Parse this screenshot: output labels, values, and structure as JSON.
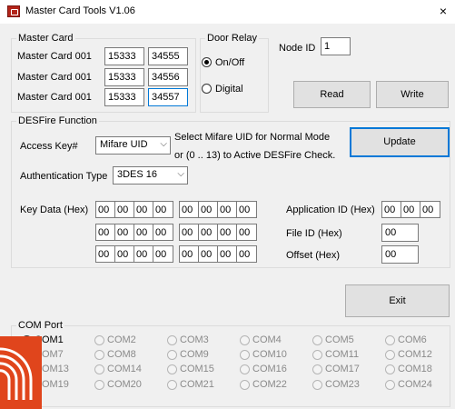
{
  "window": {
    "title": "Master Card Tools V1.06",
    "close": "×"
  },
  "master_card": {
    "legend": "Master Card",
    "rows": [
      {
        "label": "Master Card 001",
        "v1": "15333",
        "v2": "34555"
      },
      {
        "label": "Master Card 001",
        "v1": "15333",
        "v2": "34556"
      },
      {
        "label": "Master Card 001",
        "v1": "15333",
        "v2": "34557"
      }
    ]
  },
  "door_relay": {
    "legend": "Door Relay",
    "opt1": "On/Off",
    "opt2": "Digital"
  },
  "node": {
    "label": "Node ID",
    "value": "1"
  },
  "buttons": {
    "read": "Read",
    "write": "Write",
    "update": "Update",
    "exit": "Exit"
  },
  "desfire": {
    "legend": "DESFire Function",
    "access_key_label": "Access Key#",
    "access_key_value": "Mifare UID",
    "note1": "Select  Mifare UID for Normal Mode",
    "note2": "or (0 .. 13) to Active DESFire Check.",
    "auth_label": "Authentication Type",
    "auth_value": "3DES 16",
    "key_data_label": "Key Data   (Hex)",
    "key_rows": [
      [
        "00",
        "00",
        "00",
        "00",
        "00",
        "00",
        "00",
        "00"
      ],
      [
        "00",
        "00",
        "00",
        "00",
        "00",
        "00",
        "00",
        "00"
      ],
      [
        "00",
        "00",
        "00",
        "00",
        "00",
        "00",
        "00",
        "00"
      ]
    ],
    "app_id_label": "Application ID  (Hex)",
    "app_id": [
      "00",
      "00",
      "00"
    ],
    "file_id_label": "File ID    (Hex)",
    "file_id": "00",
    "offset_label": "Offset    (Hex)",
    "offset": "00"
  },
  "com_port": {
    "legend": "COM Port",
    "ports": [
      "COM1",
      "COM2",
      "COM3",
      "COM4",
      "COM5",
      "COM6",
      "COM7",
      "COM8",
      "COM9",
      "COM10",
      "COM11",
      "COM12",
      "COM13",
      "COM14",
      "COM15",
      "COM16",
      "COM17",
      "COM18",
      "COM19",
      "COM20",
      "COM21",
      "COM22",
      "COM23",
      "COM24"
    ],
    "selected": "COM1"
  },
  "icons": {
    "app": "card-icon",
    "logo": "desfire-logo"
  }
}
